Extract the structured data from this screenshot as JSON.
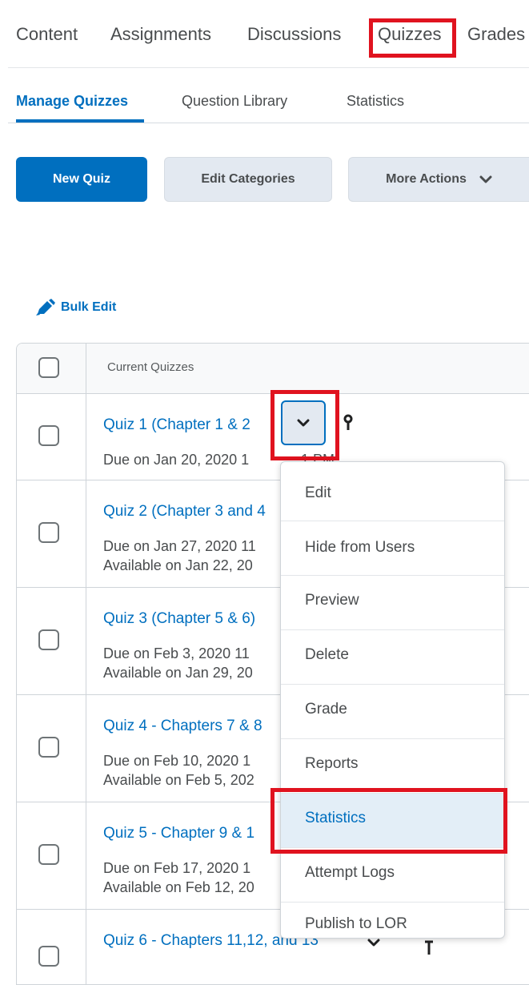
{
  "top_nav": {
    "items": [
      "Content",
      "Assignments",
      "Discussions",
      "Quizzes",
      "Grades"
    ]
  },
  "sub_tabs": {
    "items": [
      "Manage Quizzes",
      "Question Library",
      "Statistics"
    ]
  },
  "toolbar": {
    "new_quiz": "New Quiz",
    "edit_categories": "Edit Categories",
    "more_actions": "More Actions"
  },
  "bulk_edit": "Bulk Edit",
  "table": {
    "header": "Current Quizzes",
    "rows": [
      {
        "title": "Quiz 1 (Chapter 1 & 2",
        "due": "Due on Jan 20, 2020 1",
        "due_tail": "1 PM",
        "available": ""
      },
      {
        "title": "Quiz 2 (Chapter 3 and 4",
        "due": "Due on Jan 27, 2020 11",
        "available": "Available on Jan 22, 20"
      },
      {
        "title": "Quiz 3 (Chapter 5 & 6)",
        "due": "Due on Feb 3, 2020 11",
        "available": "Available on Jan 29, 20"
      },
      {
        "title": "Quiz 4 - Chapters 7 & 8",
        "due": "Due on Feb 10, 2020 1",
        "available": "Available on Feb 5, 202"
      },
      {
        "title": "Quiz 5 - Chapter 9 & 1",
        "due": "Due on Feb 17, 2020 1",
        "available": "Available on Feb 12, 20"
      },
      {
        "title": "Quiz 6 - Chapters 11,12, and 13",
        "due": "",
        "available": ""
      }
    ]
  },
  "context_menu": {
    "items": [
      "Edit",
      "Hide from Users",
      "Preview",
      "Delete",
      "Grade",
      "Reports",
      "Statistics",
      "Attempt Logs",
      "Publish to LOR"
    ],
    "highlighted": "Statistics"
  },
  "colors": {
    "primary": "#006fbf",
    "highlight_box": "#e0131f",
    "menu_selected_bg": "#e3eef7",
    "button_secondary_bg": "#e3e9f1"
  }
}
